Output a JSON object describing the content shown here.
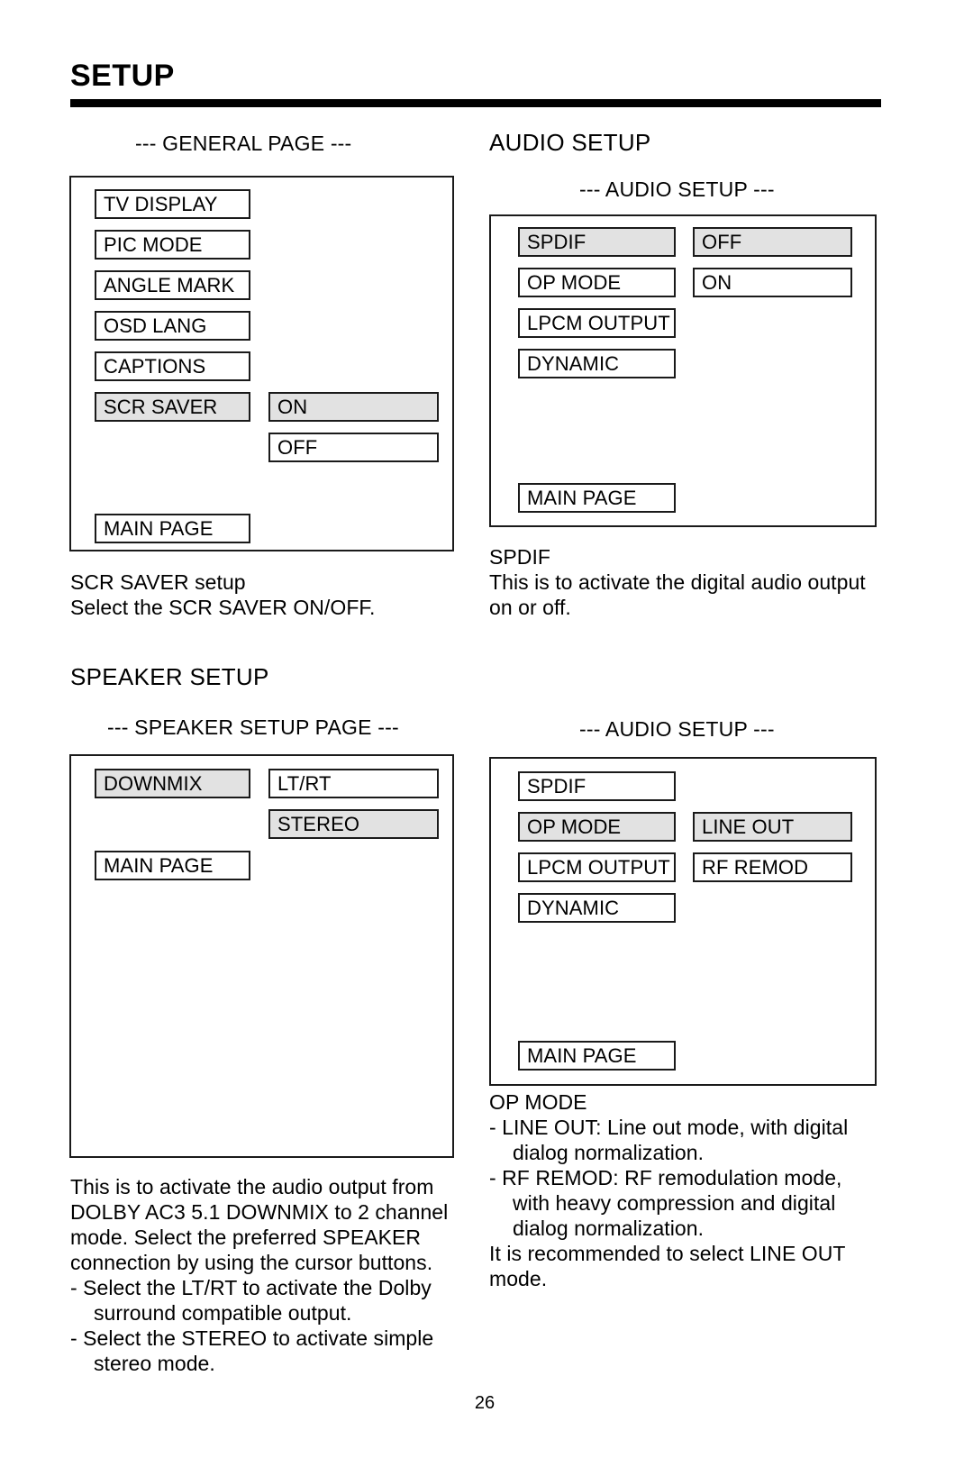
{
  "document": {
    "title": "SETUP",
    "page_number": "26"
  },
  "general_section": {
    "page_caption": "--- GENERAL PAGE ---",
    "menu_items": [
      {
        "label": "TV DISPLAY",
        "highlighted": false
      },
      {
        "label": "PIC MODE",
        "highlighted": false
      },
      {
        "label": "ANGLE MARK",
        "highlighted": false
      },
      {
        "label": "OSD LANG",
        "highlighted": false
      },
      {
        "label": "CAPTIONS",
        "highlighted": false
      },
      {
        "label": "SCR SAVER",
        "highlighted": true
      }
    ],
    "options": [
      {
        "label": "ON",
        "highlighted": true
      },
      {
        "label": "OFF",
        "highlighted": false
      }
    ],
    "main_page_label": "MAIN PAGE",
    "description": [
      "SCR SAVER setup",
      "Select the SCR SAVER ON/OFF."
    ]
  },
  "audio_section": {
    "heading": "AUDIO SETUP",
    "page_caption": "--- AUDIO SETUP ---",
    "menu_items": [
      {
        "label": "SPDIF",
        "highlighted": true
      },
      {
        "label": "OP MODE",
        "highlighted": false
      },
      {
        "label": "LPCM OUTPUT",
        "highlighted": false
      },
      {
        "label": "DYNAMIC",
        "highlighted": false
      }
    ],
    "options": [
      {
        "label": "OFF",
        "highlighted": true
      },
      {
        "label": "ON",
        "highlighted": false
      }
    ],
    "main_page_label": "MAIN PAGE",
    "description": [
      "SPDIF",
      "This is to activate the digital audio output",
      "on or off."
    ]
  },
  "speaker_section": {
    "heading": "SPEAKER SETUP",
    "page_caption": "--- SPEAKER SETUP PAGE ---",
    "menu_items": [
      {
        "label": "DOWNMIX",
        "highlighted": true
      }
    ],
    "options": [
      {
        "label": "LT/RT",
        "highlighted": false
      },
      {
        "label": "STEREO",
        "highlighted": true
      }
    ],
    "main_page_label": "MAIN PAGE",
    "description": {
      "paragraph": [
        "This is to activate the audio output from",
        "DOLBY AC3 5.1 DOWNMIX to 2 channel",
        "mode.  Select the preferred SPEAKER",
        "connection by using the cursor buttons."
      ],
      "bullets": [
        {
          "first": "-  Select the LT/RT to activate the Dolby",
          "rest": [
            "surround compatible output."
          ]
        },
        {
          "first": "-  Select the STEREO to activate simple",
          "rest": [
            "stereo mode."
          ]
        }
      ]
    }
  },
  "opmode_section": {
    "page_caption": "--- AUDIO SETUP ---",
    "menu_items": [
      {
        "label": "SPDIF",
        "highlighted": false
      },
      {
        "label": "OP MODE",
        "highlighted": true
      },
      {
        "label": "LPCM OUTPUT",
        "highlighted": false
      },
      {
        "label": "DYNAMIC",
        "highlighted": false
      }
    ],
    "options": [
      {
        "label": "LINE OUT",
        "highlighted": true
      },
      {
        "label": "RF REMOD",
        "highlighted": false
      }
    ],
    "main_page_label": "MAIN PAGE",
    "description": {
      "title": "OP MODE",
      "bullets": [
        {
          "first": "-  LINE OUT: Line out mode, with digital",
          "rest": [
            "dialog normalization."
          ]
        },
        {
          "first": "-  RF REMOD: RF remodulation mode,",
          "rest": [
            "with heavy compression and digital",
            "dialog normalization."
          ]
        }
      ],
      "closing": [
        "It is recommended to select LINE OUT",
        "mode."
      ]
    }
  },
  "colors": {
    "highlight": "#e2e2e2",
    "border": "#1a1a1a",
    "text": "#000000",
    "rule": "#000000"
  }
}
